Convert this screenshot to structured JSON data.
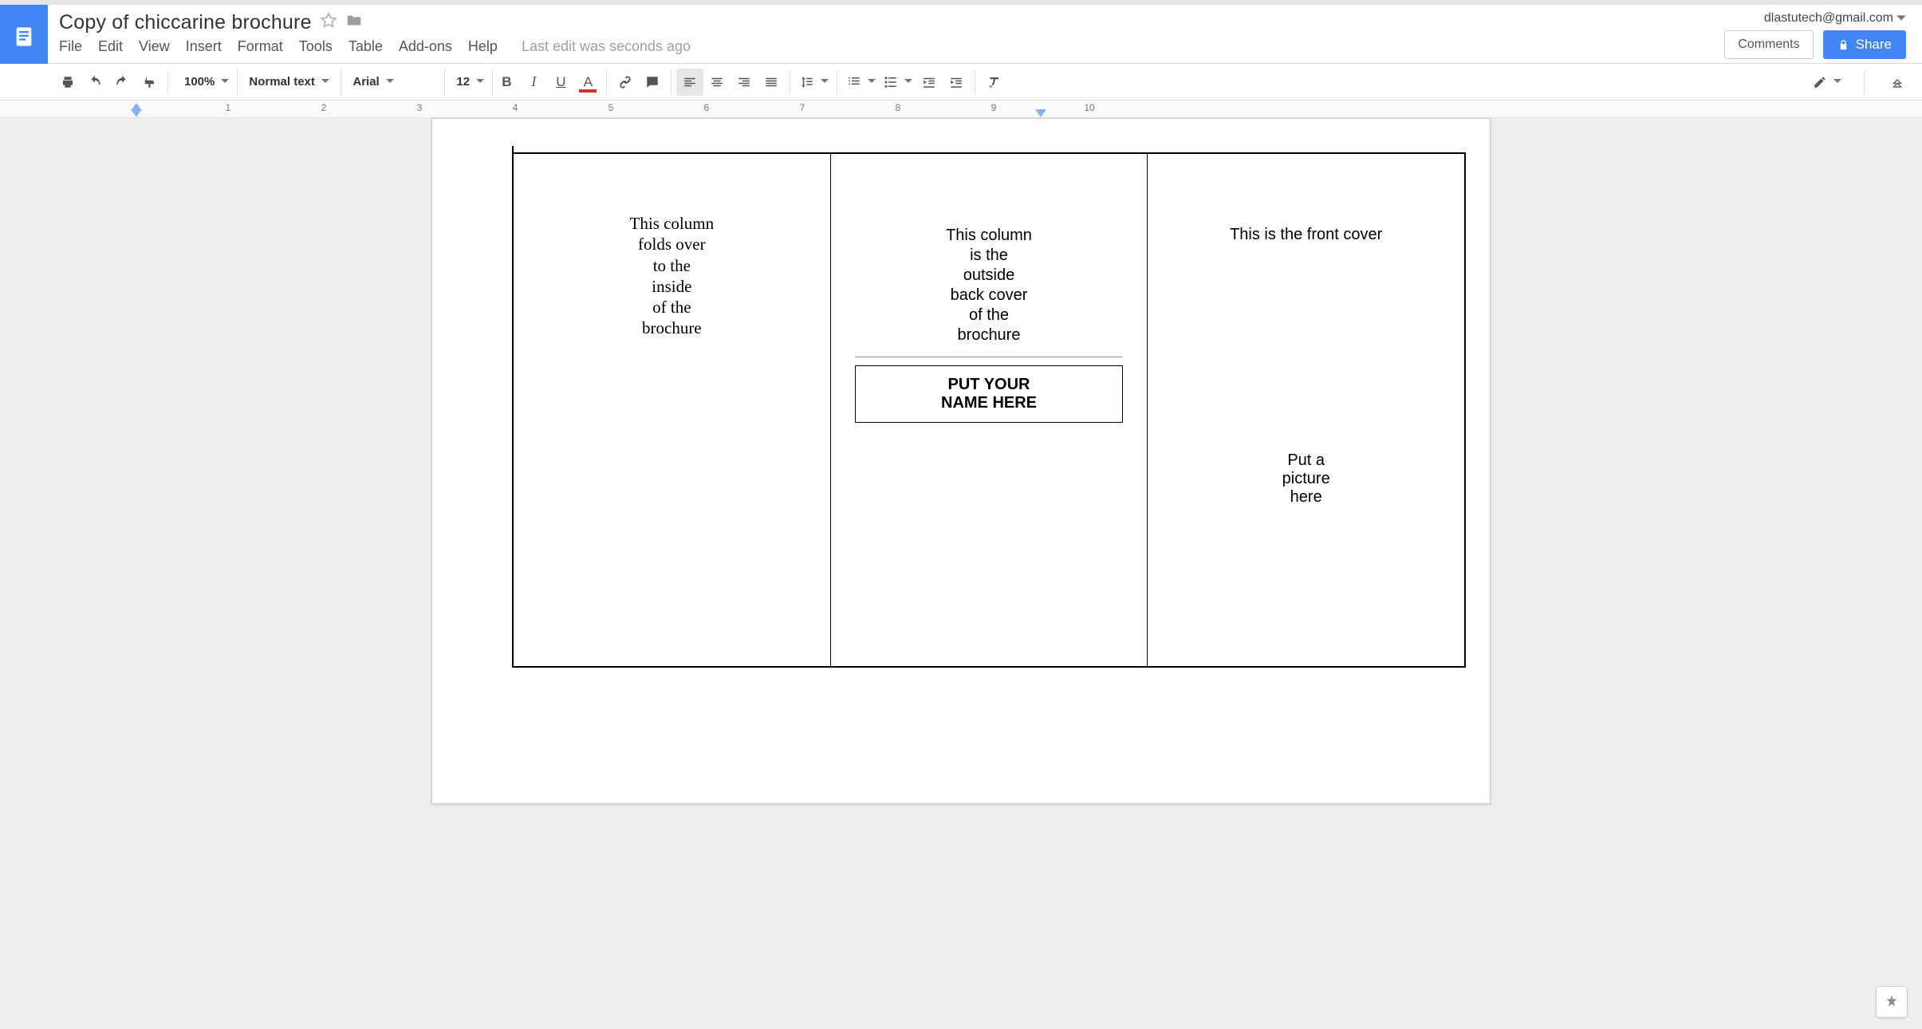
{
  "account_email": "dlastutech@gmail.com",
  "doc_title": "Copy of chiccarine brochure",
  "menu": {
    "file": "File",
    "edit": "Edit",
    "view": "View",
    "insert": "Insert",
    "format": "Format",
    "tools": "Tools",
    "table": "Table",
    "addons": "Add-ons",
    "help": "Help"
  },
  "last_edit": "Last edit was seconds ago",
  "buttons": {
    "comments": "Comments",
    "share": "Share"
  },
  "toolbar": {
    "zoom": "100%",
    "style": "Normal text",
    "font": "Arial",
    "size": "12"
  },
  "ruler_numbers": [
    "1",
    "2",
    "3",
    "4",
    "5",
    "6",
    "7",
    "8",
    "9",
    "10"
  ],
  "doc": {
    "col1": "This column\nfolds over\nto the\ninside\nof the\nbrochure",
    "col2": "This column\nis the\noutside\nback cover\nof the\nbrochure",
    "name_box": "PUT YOUR\nNAME HERE",
    "col3_title": "This is the front cover",
    "col3_pic": "Put a\npicture\nhere"
  }
}
